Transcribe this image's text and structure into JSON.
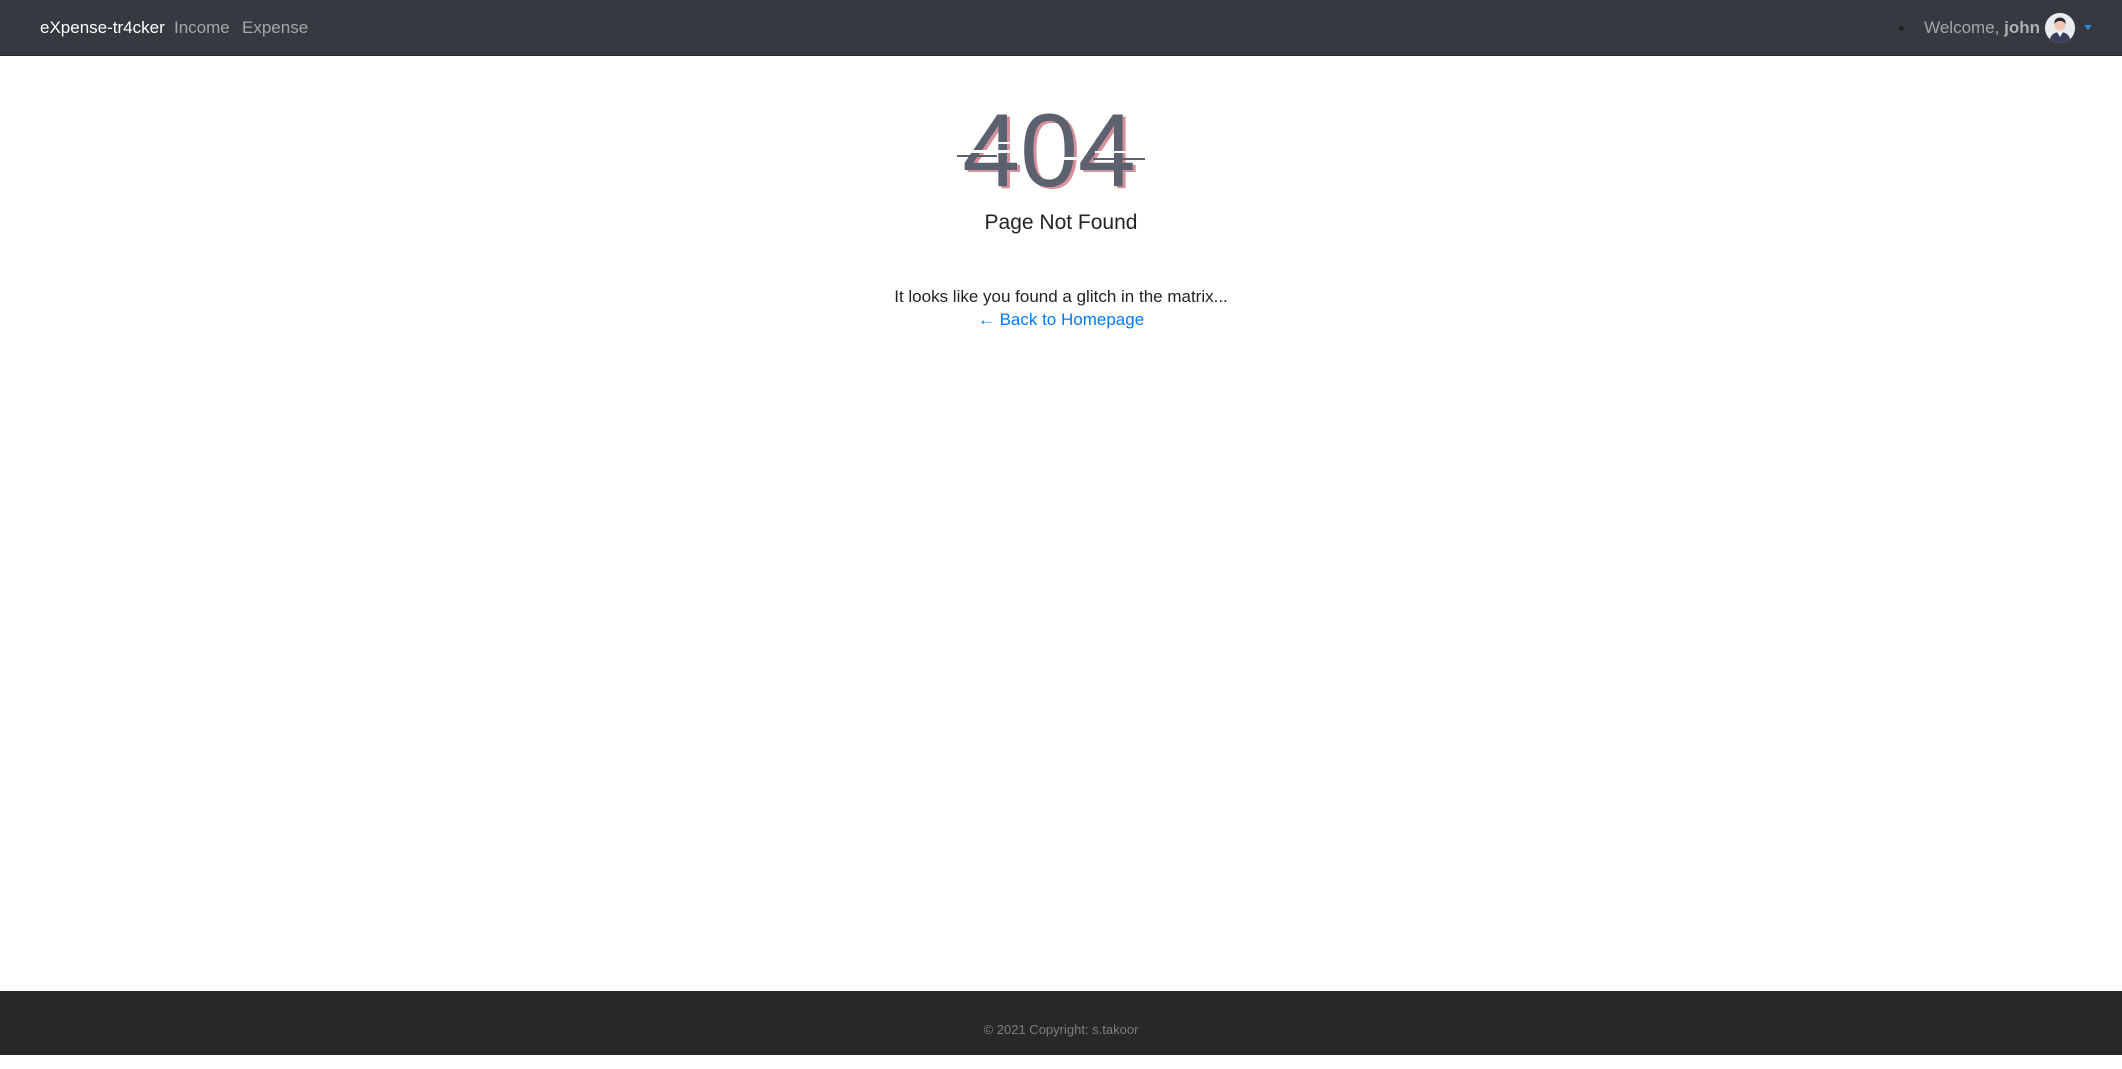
{
  "navbar": {
    "brand": "eXpense-tr4cker",
    "links": [
      "Income",
      "Expense"
    ],
    "welcome_text": "Welcome, ",
    "username": "john"
  },
  "error": {
    "code": "404",
    "title": "Page Not Found",
    "message": "It looks like you found a glitch in the matrix...",
    "back_link": "← Back to Homepage"
  },
  "footer": {
    "copyright": "© 2021 Copyright: s.takoor"
  },
  "colors": {
    "navbar_bg": "#343a40",
    "footer_bg": "#282828",
    "error_code": "#5c6170",
    "glitch_red": "#b3364a",
    "link": "#007bff"
  }
}
